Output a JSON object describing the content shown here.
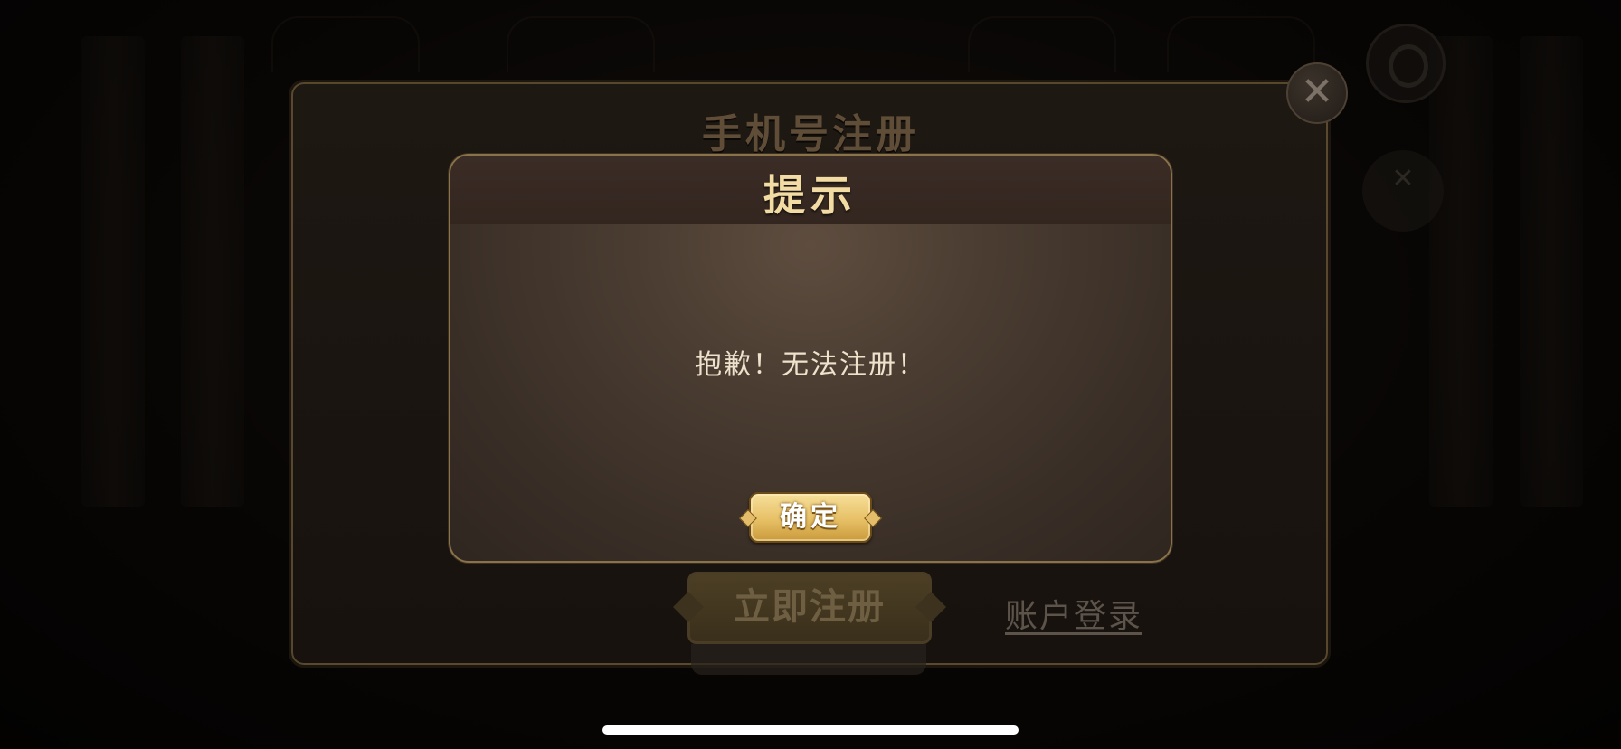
{
  "register_panel": {
    "title": "手机号注册",
    "register_now_label": "立即注册",
    "account_login_label": "账户登录",
    "close_icon": "close-icon"
  },
  "tip_dialog": {
    "title": "提示",
    "message": "抱歉！无法注册！",
    "confirm_label": "确定"
  },
  "background": {
    "service_icon": "headset-icon",
    "tool_icon": "tools-icon"
  },
  "colors": {
    "accent_gold": "#e7c066",
    "title_gold": "#f3dca4",
    "dialog_border": "#8a7249"
  }
}
